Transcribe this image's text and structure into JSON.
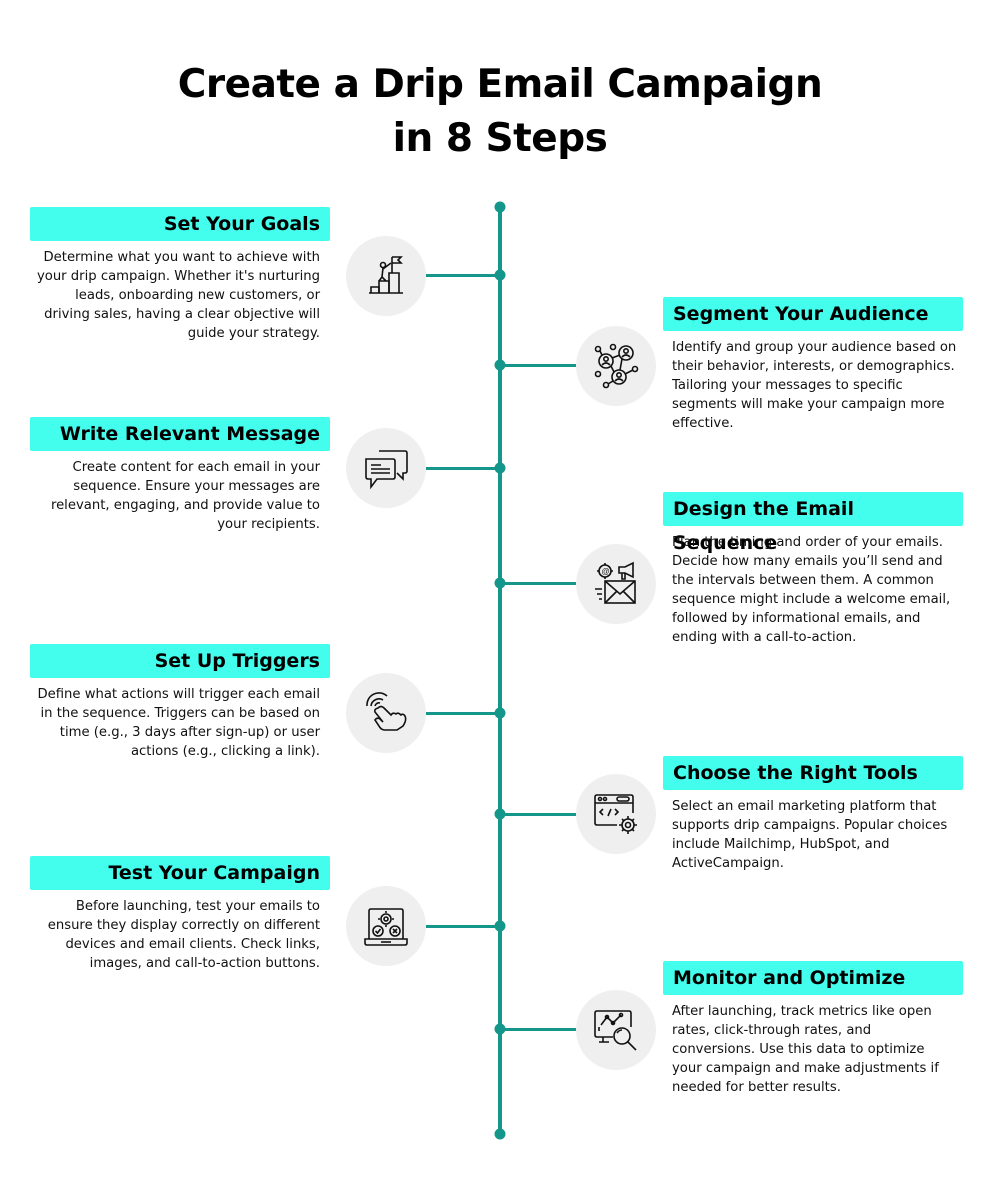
{
  "title": {
    "line1": "Create a Drip Email Campaign",
    "line2": "in 8 Steps"
  },
  "colors": {
    "accent_teal": "#14968a",
    "title_highlight": "#43fded",
    "icon_bg": "#efefef"
  },
  "steps": [
    {
      "side": "left",
      "title": "Set Your Goals",
      "icon": "goal-climb-flag-icon",
      "description": "Determine what you want to achieve with your drip campaign. Whether it's nurturing leads, onboarding new customers, or driving sales, having a clear objective will guide your strategy."
    },
    {
      "side": "right",
      "title": "Segment Your Audience",
      "icon": "audience-network-icon",
      "description": "Identify and group your audience based on their behavior, interests, or demographics. Tailoring your messages to specific segments will make your campaign more effective."
    },
    {
      "side": "left",
      "title": "Write Relevant Message",
      "icon": "chat-bubbles-icon",
      "description": "Create content for each email in your sequence. Ensure your messages are relevant, engaging, and provide value to your recipients."
    },
    {
      "side": "right",
      "title": "Design the Email Sequence",
      "icon": "email-megaphone-icon",
      "description": "Plan the timing and order of your emails. Decide how many emails you’ll send and the intervals between them. A common sequence might include a welcome email, followed by informational emails, and ending with a call-to-action."
    },
    {
      "side": "left",
      "title": "Set Up Triggers",
      "icon": "tap-hand-icon",
      "description": "Define what actions will trigger each email in the sequence. Triggers can be based on time (e.g., 3 days after sign-up) or user actions (e.g., clicking a link)."
    },
    {
      "side": "right",
      "title": "Choose the Right Tools",
      "icon": "browser-code-gear-icon",
      "description": "Select an email marketing platform that supports drip campaigns. Popular choices include Mailchimp, HubSpot, and ActiveCampaign."
    },
    {
      "side": "left",
      "title": "Test Your Campaign",
      "icon": "laptop-test-icon",
      "description": "Before launching, test your emails to ensure they display correctly on different devices and email clients. Check links, images, and call-to-action buttons."
    },
    {
      "side": "right",
      "title": "Monitor and Optimize",
      "icon": "analytics-magnifier-icon",
      "description": "After launching, track metrics like open rates, click-through rates, and conversions. Use this data to optimize your campaign and make adjustments if needed for better results."
    }
  ]
}
